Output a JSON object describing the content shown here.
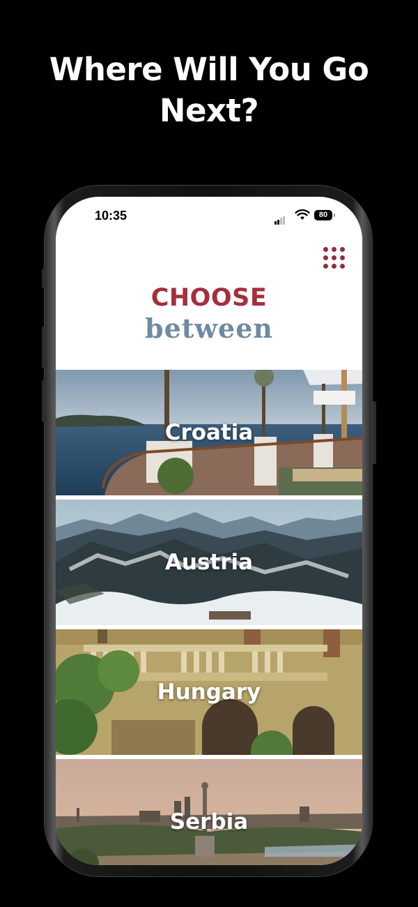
{
  "headline": {
    "line1": "Where Will You Go",
    "line2": "Next?"
  },
  "status_bar": {
    "time": "10:35",
    "battery": "80"
  },
  "header": {
    "menu_icon": "grid-dots-icon",
    "title_top": "CHOOSE",
    "title_bottom": "between"
  },
  "destinations": [
    {
      "label": "Croatia"
    },
    {
      "label": "Austria"
    },
    {
      "label": "Hungary"
    },
    {
      "label": "Serbia"
    }
  ],
  "colors": {
    "accent": "#a52f3d",
    "subtitle": "#6f8aa1",
    "background": "#000000"
  }
}
